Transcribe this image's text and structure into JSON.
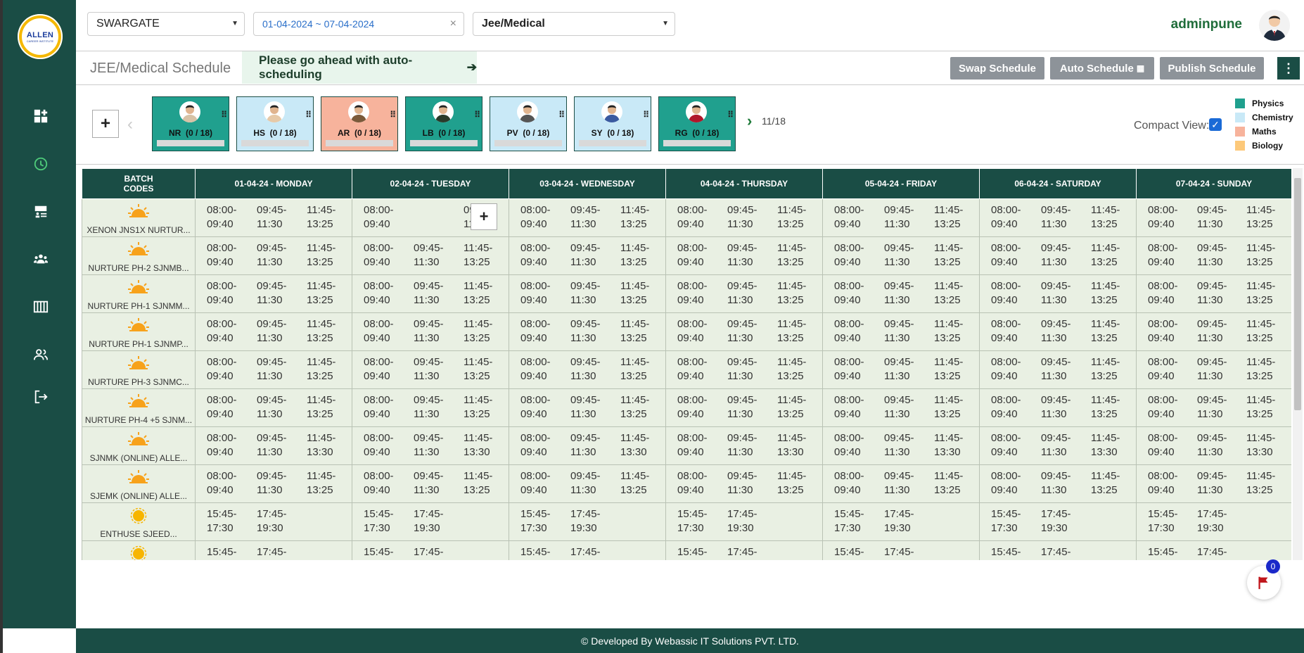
{
  "logo": {
    "text": "ALLEN",
    "sub": "CAREER INSTITUTE"
  },
  "sidebar": {
    "items": [
      {
        "icon": "dashboard-add-icon"
      },
      {
        "icon": "clock-icon",
        "active": true
      },
      {
        "icon": "classroom-icon"
      },
      {
        "icon": "group-icon"
      },
      {
        "icon": "timetable-icon"
      },
      {
        "icon": "people-icon"
      },
      {
        "icon": "logout-icon"
      }
    ]
  },
  "header": {
    "center_select": "SWARGATE",
    "date_range": "01-04-2024 ~ 07-04-2024",
    "stream_select": "Jee/Medical",
    "username": "adminpune"
  },
  "subheader": {
    "title": "JEE/Medical Schedule",
    "banner": "Please go ahead with auto-scheduling",
    "swap_btn": "Swap Schedule",
    "auto_btn": "Auto Schedule",
    "publish_btn": "Publish Schedule"
  },
  "teachers": {
    "add_label": "+",
    "page_count": "11/18",
    "cards": [
      {
        "name": "NR",
        "count": "(0 / 18)",
        "subject": "Physics"
      },
      {
        "name": "HS",
        "count": "(0 / 18)",
        "subject": "Chemistry"
      },
      {
        "name": "AR",
        "count": "(0 / 18)",
        "subject": "Maths"
      },
      {
        "name": "LB",
        "count": "(0 / 18)",
        "subject": "Physics"
      },
      {
        "name": "PV",
        "count": "(0 / 18)",
        "subject": "Chemistry"
      },
      {
        "name": "SY",
        "count": "(0 / 18)",
        "subject": "Chemistry"
      },
      {
        "name": "RG",
        "count": "(0 / 18)",
        "subject": "Physics"
      }
    ],
    "compact_label": "Compact View:",
    "legend": [
      {
        "label": "Physics",
        "color": "#20a08e"
      },
      {
        "label": "Chemistry",
        "color": "#c9e9f7"
      },
      {
        "label": "Maths",
        "color": "#f7b39c"
      },
      {
        "label": "Biology",
        "color": "#fdc97a"
      }
    ]
  },
  "schedule": {
    "batch_header": "BATCH CODES",
    "days": [
      "01-04-24 - MONDAY",
      "02-04-24 - TUESDAY",
      "03-04-24 - WEDNESDAY",
      "04-04-24 - THURSDAY",
      "05-04-24 - FRIDAY",
      "06-04-24 - SATURDAY",
      "07-04-24 - SUNDAY"
    ],
    "rows": [
      {
        "batch": "XENON JNS1X NURTUR...",
        "icon": "sunrise",
        "slots": [
          "08:00-\n09:40",
          "09:45-\n11:30",
          "11:45-\n13:25"
        ]
      },
      {
        "batch": "NURTURE PH-2 SJNMB...",
        "icon": "sunrise",
        "slots": [
          "08:00-\n09:40",
          "09:45-\n11:30",
          "11:45-\n13:25"
        ]
      },
      {
        "batch": "NURTURE PH-1 SJNMM...",
        "icon": "sunrise",
        "slots": [
          "08:00-\n09:40",
          "09:45-\n11:30",
          "11:45-\n13:25"
        ]
      },
      {
        "batch": "NURTURE PH-1 SJNMP...",
        "icon": "sunrise",
        "slots": [
          "08:00-\n09:40",
          "09:45-\n11:30",
          "11:45-\n13:25"
        ]
      },
      {
        "batch": "NURTURE PH-3 SJNMC...",
        "icon": "sunrise",
        "slots": [
          "08:00-\n09:40",
          "09:45-\n11:30",
          "11:45-\n13:25"
        ]
      },
      {
        "batch": "NURTURE PH-4 +5 SJNM...",
        "icon": "sunrise",
        "slots": [
          "08:00-\n09:40",
          "09:45-\n11:30",
          "11:45-\n13:25"
        ]
      },
      {
        "batch": "SJNMK (ONLINE) ALLE...",
        "icon": "sunrise",
        "slots": [
          "08:00-\n09:40",
          "09:45-\n11:30",
          "11:45-\n13:30"
        ]
      },
      {
        "batch": "SJEMK (ONLINE) ALLE...",
        "icon": "sunrise",
        "slots": [
          "08:00-\n09:40",
          "09:45-\n11:30",
          "11:45-\n13:25"
        ]
      },
      {
        "batch": "ENTHUSE SJEED...",
        "icon": "sun",
        "slots": [
          "15:45-\n17:30",
          "17:45-\n19:30"
        ]
      },
      {
        "batch": "",
        "icon": "sun",
        "slots": [
          "15:45-",
          "17:45-"
        ]
      }
    ]
  },
  "flag": {
    "count": "0"
  },
  "footer": {
    "text": "© Developed By Webassic IT Solutions PVT. LTD."
  }
}
